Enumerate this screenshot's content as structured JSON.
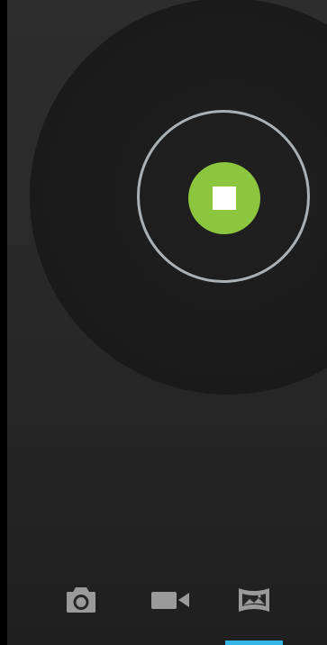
{
  "app": {
    "screen": "camera-recording"
  },
  "colors": {
    "record_button": "#8cc63f",
    "stop_icon": "#ffffff",
    "ring": "#aab0b4",
    "active_indicator": "#33b5e5",
    "mode_icon": "#9a9a9a",
    "background": "#2a2a2a"
  },
  "shutter": {
    "state": "recording",
    "icon": "stop-icon"
  },
  "mode_bar": {
    "modes": [
      {
        "id": "camera",
        "icon": "camera-icon",
        "active": false
      },
      {
        "id": "video",
        "icon": "video-camera-icon",
        "active": false
      },
      {
        "id": "panorama",
        "icon": "panorama-icon",
        "active": true
      }
    ]
  }
}
